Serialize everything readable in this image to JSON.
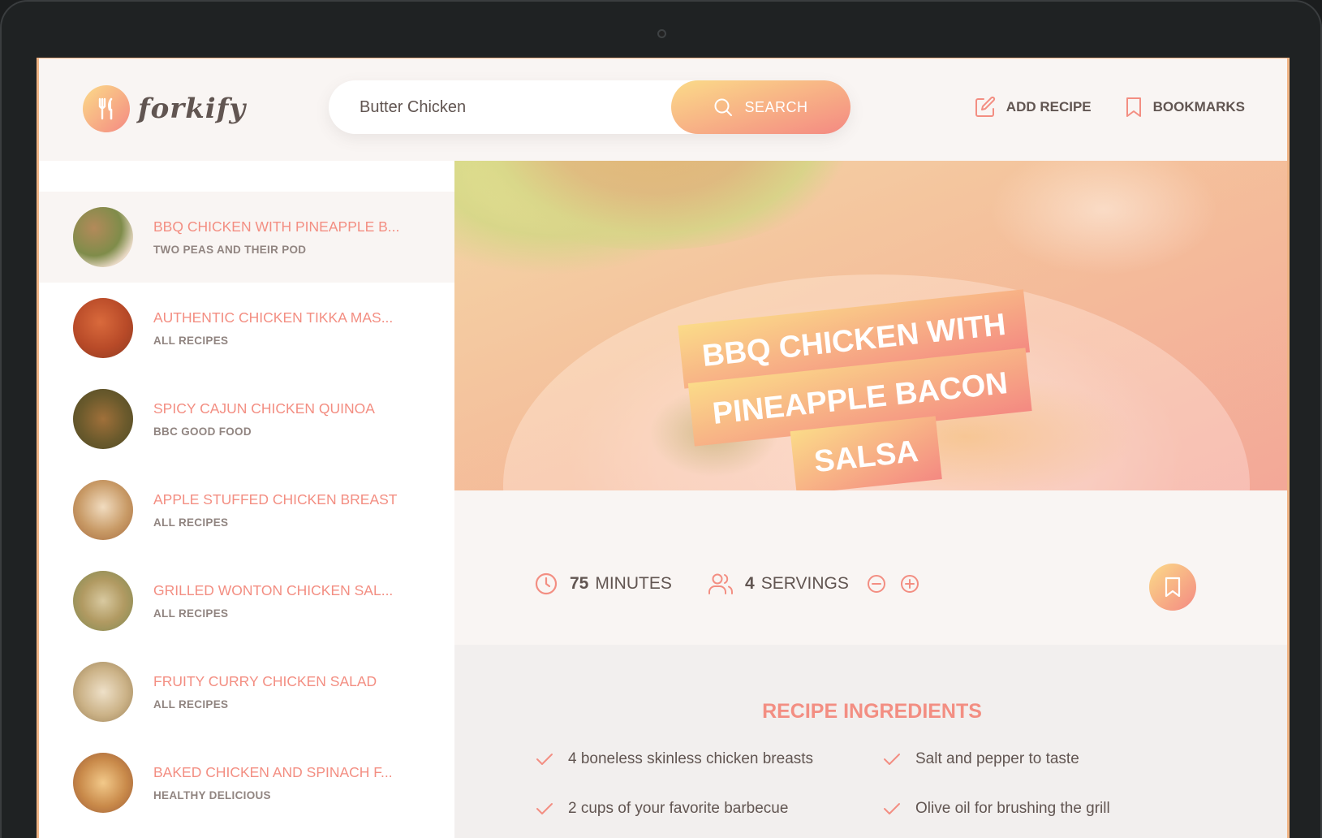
{
  "app": {
    "name": "forkify",
    "accent_light": "#fbdb89",
    "accent_dark": "#f48982",
    "text_color": "#615551"
  },
  "search": {
    "value": "Butter Chicken",
    "button_label": "Search"
  },
  "nav": {
    "add_recipe": "Add recipe",
    "bookmarks": "Bookmarks"
  },
  "results": [
    {
      "title": "BBQ Chicken with Pineapple B...",
      "publisher": "Two Peas and Their Pod",
      "active": true
    },
    {
      "title": "Authentic Chicken Tikka Mas...",
      "publisher": "All Recipes"
    },
    {
      "title": "Spicy Cajun Chicken Quinoa",
      "publisher": "BBC Good Food"
    },
    {
      "title": "Apple Stuffed Chicken Breast",
      "publisher": "All Recipes"
    },
    {
      "title": "Grilled Wonton Chicken Sal...",
      "publisher": "All Recipes"
    },
    {
      "title": "Fruity Curry Chicken Salad",
      "publisher": "All Recipes"
    },
    {
      "title": "Baked Chicken and Spinach F...",
      "publisher": "Healthy Delicious"
    }
  ],
  "recipe": {
    "title_lines": [
      "BBQ Chicken with",
      "Pineapple Bacon",
      "Salsa"
    ],
    "minutes_value": "75",
    "minutes_label": "minutes",
    "servings_value": "4",
    "servings_label": "servings",
    "ingredients_heading": "Recipe ingredients",
    "ingredients": [
      "4 boneless skinless chicken breasts",
      "Salt and pepper to taste",
      "2 cups of your favorite barbecue",
      "Olive oil for brushing the grill"
    ]
  }
}
